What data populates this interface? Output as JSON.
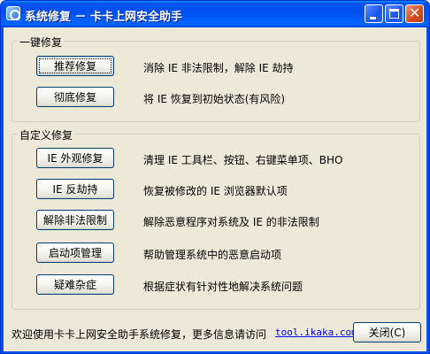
{
  "window": {
    "title": "系统修复 － 卡卡上网安全助手"
  },
  "group_quick": {
    "label": "一键修复",
    "items": [
      {
        "button": "推荐修复",
        "desc": "消除 IE 非法限制，解除 IE 劫持"
      },
      {
        "button": "彻底修复",
        "desc": "将 IE 恢复到初始状态(有风险)"
      }
    ]
  },
  "group_custom": {
    "label": "自定义修复",
    "items": [
      {
        "button": "IE 外观修复",
        "desc": "清理 IE 工具栏、按钮、右键菜单项、BHO"
      },
      {
        "button": "IE 反劫持",
        "desc": "恢复被修改的 IE 浏览器默认项"
      },
      {
        "button": "解除非法限制",
        "desc": "解除恶意程序对系统及 IE 的非法限制"
      },
      {
        "button": "启动项管理",
        "desc": "帮助管理系统中的恶意启动项"
      },
      {
        "button": "疑难杂症",
        "desc": "根据症状有针对性地解决系统问题"
      }
    ]
  },
  "footer": {
    "text": "欢迎使用卡卡上网安全助手系统修复，更多信息请访问",
    "link": "tool.ikaka.com",
    "close_button": "关闭(C)"
  }
}
